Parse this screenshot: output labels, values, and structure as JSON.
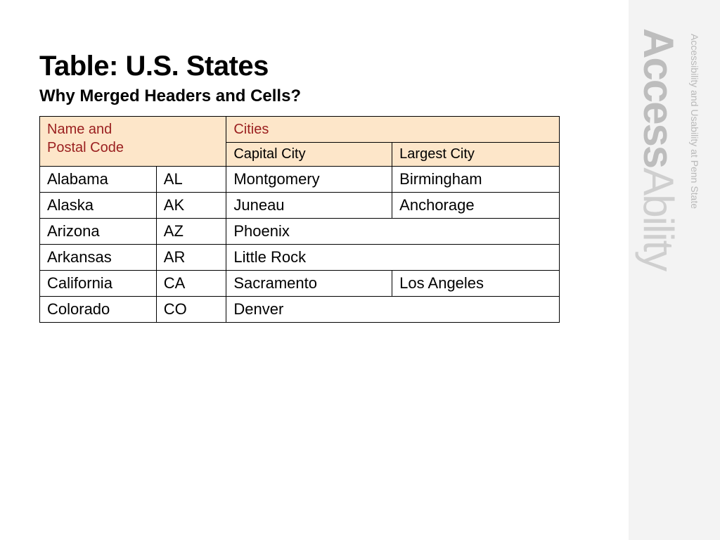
{
  "title": "Table: U.S. States",
  "subtitle": "Why Merged Headers and Cells?",
  "headers": {
    "name_code": "Name and\nPostal Code",
    "cities": "Cities",
    "capital": "Capital City",
    "largest": "Largest City"
  },
  "rows": [
    {
      "state": "Alabama",
      "code": "AL",
      "capital": "Montgomery",
      "largest": "Birmingham",
      "merged": false
    },
    {
      "state": "Alaska",
      "code": "AK",
      "capital": "Juneau",
      "largest": "Anchorage",
      "merged": false
    },
    {
      "state": "Arizona",
      "code": "AZ",
      "capital": "Phoenix",
      "largest": "Phoenix",
      "merged": true
    },
    {
      "state": "Arkansas",
      "code": "AR",
      "capital": "Little Rock",
      "largest": "Little Rock",
      "merged": true
    },
    {
      "state": "California",
      "code": "CA",
      "capital": "Sacramento",
      "largest": "Los Angeles",
      "merged": false
    },
    {
      "state": "Colorado",
      "code": "CO",
      "capital": "Denver",
      "largest": "Denver",
      "merged": true
    }
  ],
  "brand": {
    "logo_bold": "Access",
    "logo_thin": "Ability",
    "tagline": "Accessibility and Usability at Penn State"
  }
}
